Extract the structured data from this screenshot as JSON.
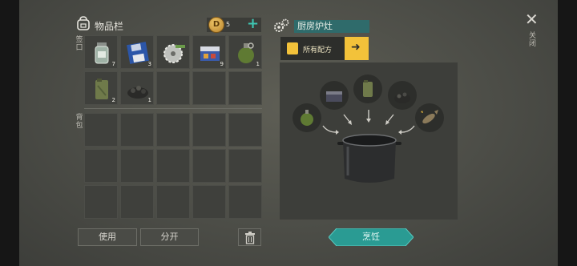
{
  "inventory": {
    "title": "物品栏",
    "coins": "5",
    "quick_label": "签口",
    "backpack_label": "背包",
    "quick_slots": [
      {
        "icon": "glass-jar-icon",
        "count": "7"
      },
      {
        "icon": "floppy-disk-icon",
        "count": "3"
      },
      {
        "icon": "saw-blade-icon",
        "count": ""
      },
      {
        "icon": "battery-box-icon",
        "count": "9"
      },
      {
        "icon": "grenade-icon",
        "count": "1"
      },
      {
        "icon": "jerry-can-icon",
        "count": "2"
      },
      {
        "icon": "coal-pile-icon",
        "count": "1"
      }
    ],
    "use_label": "使用",
    "split_label": "分开"
  },
  "crafting": {
    "station_name": "厨房炉灶",
    "recipes_label": "所有配方",
    "cook_label": "烹饪",
    "close_label": "关闭"
  },
  "colors": {
    "accent": "#2f6b6b",
    "cook_button": "#2a9b93",
    "highlight": "#f3c23a"
  }
}
